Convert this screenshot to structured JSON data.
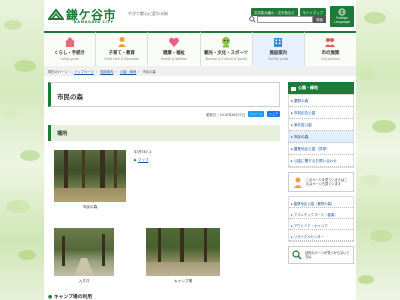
{
  "header": {
    "logo_jp": "鎌ケ谷市",
    "logo_en": "KAMAGAYA CITY",
    "tagline": "やがて都心に変わる街",
    "util_buttons": [
      "文字拡大縮小・文字色など",
      "サイトマップ"
    ],
    "search_placeholder": "",
    "search_button": "検索",
    "lang_label": "Foreign\nLanguage"
  },
  "nav": [
    {
      "jp": "くらし・手続き",
      "en": "Living guide",
      "icon": "house-icon"
    },
    {
      "jp": "子育て・教育",
      "en": "Child care & Education",
      "icon": "child-icon"
    },
    {
      "jp": "健康・福祉",
      "en": "Health & Welfare",
      "icon": "heart-icon"
    },
    {
      "jp": "観光・文化・スポーツ",
      "en": "Tourism & Culture & Sports",
      "icon": "mascot-icon"
    },
    {
      "jp": "施設案内",
      "en": "Facility guide",
      "icon": "building-icon",
      "active": true
    },
    {
      "jp": "市の施策",
      "en": "City policies",
      "icon": "people-icon"
    }
  ],
  "breadcrumb": {
    "current_label": "現在のページ",
    "items": [
      "トップページ",
      "施設案内",
      "公園・緑地",
      "市民の森"
    ]
  },
  "main": {
    "title": "市民の森",
    "updated": "更新日：2018年6月25日",
    "share_labels": [
      "ツイート",
      "シェア"
    ],
    "section_location": "場所",
    "address": "中沢787-1",
    "map_link": "マップ",
    "photos": [
      {
        "caption": "市民の森"
      },
      {
        "caption": "入り口"
      },
      {
        "caption": "キャンプ場"
      }
    ],
    "section_camp": "キャンプ場の利用"
  },
  "sidebar": {
    "heading": "公園・緑地",
    "items": [
      "粟野の森",
      "市制記念公園",
      "東初富公園",
      "市民の森",
      "農業地区公園（貝塚）",
      "公園に関するお問い合わせ"
    ],
    "current_index": 3,
    "help_text": "このページを見ている人はこんなページも見ています",
    "related": [
      "農業地区公園（粟野の森）",
      "アスレチックコース（健康）",
      "アウトドア・キャンプ",
      "リサイクルセンター"
    ],
    "find_text": "目的のページが見つからないときは"
  },
  "colors": {
    "accent": "#1e7a37",
    "link": "#1e5aa8",
    "section_bg": "#e6f0dd"
  }
}
